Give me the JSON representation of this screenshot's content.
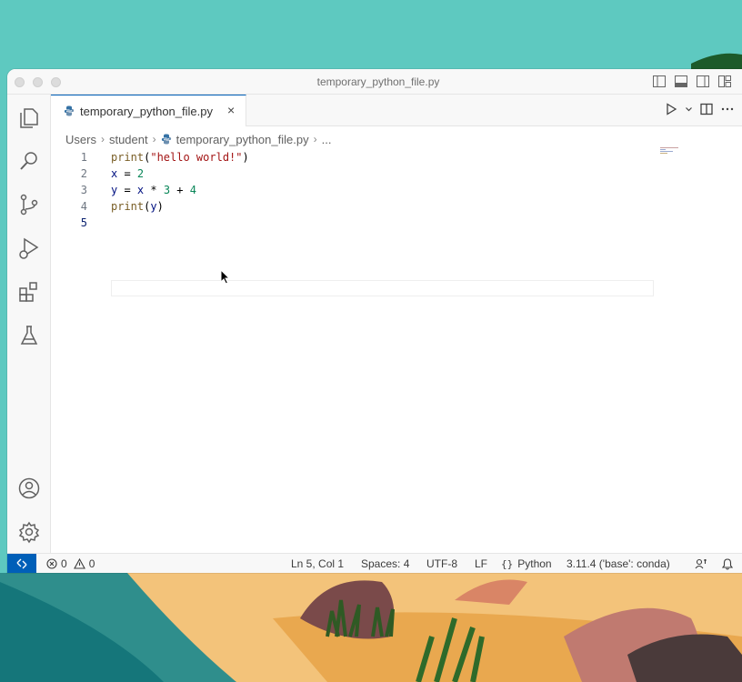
{
  "window": {
    "title": "temporary_python_file.py"
  },
  "tab": {
    "label": "temporary_python_file.py",
    "close": "×"
  },
  "breadcrumb": {
    "items": [
      "Users",
      "student",
      "temporary_python_file.py",
      "..."
    ]
  },
  "editor": {
    "line_numbers": [
      "1",
      "2",
      "3",
      "4",
      "5"
    ],
    "lines": [
      {
        "tokens": [
          {
            "t": "print",
            "c": "fn"
          },
          {
            "t": "(",
            "c": ""
          },
          {
            "t": "\"hello world!\"",
            "c": "str"
          },
          {
            "t": ")",
            "c": ""
          }
        ]
      },
      {
        "tokens": [
          {
            "t": "x",
            "c": "var"
          },
          {
            "t": " = ",
            "c": ""
          },
          {
            "t": "2",
            "c": "num"
          }
        ]
      },
      {
        "tokens": [
          {
            "t": "y",
            "c": "var"
          },
          {
            "t": " = ",
            "c": ""
          },
          {
            "t": "x",
            "c": "var"
          },
          {
            "t": " * ",
            "c": ""
          },
          {
            "t": "3",
            "c": "num"
          },
          {
            "t": " + ",
            "c": ""
          },
          {
            "t": "4",
            "c": "num"
          }
        ]
      },
      {
        "tokens": [
          {
            "t": "print",
            "c": "fn"
          },
          {
            "t": "(",
            "c": ""
          },
          {
            "t": "y",
            "c": "var"
          },
          {
            "t": ")",
            "c": ""
          }
        ]
      },
      {
        "tokens": []
      }
    ],
    "active_line": 5
  },
  "activity_bar": {
    "items": [
      "explorer-icon",
      "search-icon",
      "source-control-icon",
      "run-debug-icon",
      "extensions-icon",
      "testing-icon"
    ],
    "bottom": [
      "accounts-icon",
      "manage-gear-icon"
    ]
  },
  "status": {
    "errors": "0",
    "warnings": "0",
    "position": "Ln 5, Col 1",
    "spaces": "Spaces: 4",
    "encoding": "UTF-8",
    "eol": "LF",
    "language": "Python",
    "interpreter": "3.11.4 ('base': conda)"
  },
  "colors": {
    "accent": "#005fb8",
    "wallpaper_sky": "#5ec9c0",
    "sand": "#e9a84f"
  }
}
